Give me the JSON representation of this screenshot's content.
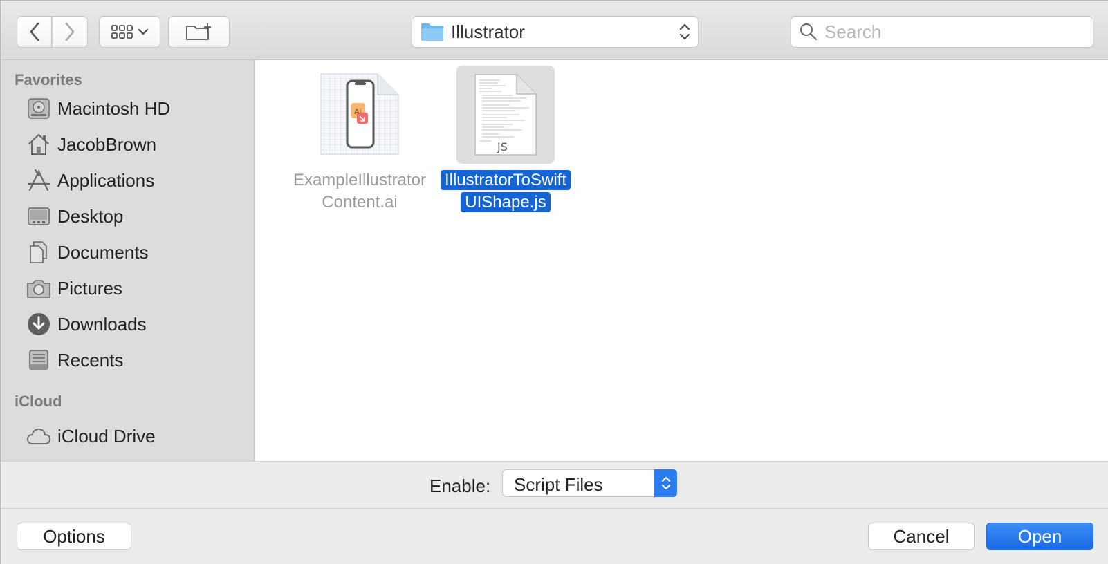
{
  "toolbar": {
    "back_icon": "chevron-left-icon",
    "forward_icon": "chevron-right-icon",
    "view_icon": "grid-view-icon",
    "new_folder_icon": "new-folder-icon",
    "location": "Illustrator",
    "search_placeholder": "Search"
  },
  "sidebar": {
    "favorites_title": "Favorites",
    "favorites": [
      {
        "label": "Macintosh HD",
        "icon": "hard-drive-icon"
      },
      {
        "label": "JacobBrown",
        "icon": "home-icon"
      },
      {
        "label": "Applications",
        "icon": "applications-icon"
      },
      {
        "label": "Desktop",
        "icon": "desktop-icon"
      },
      {
        "label": "Documents",
        "icon": "documents-icon"
      },
      {
        "label": "Pictures",
        "icon": "camera-icon"
      },
      {
        "label": "Downloads",
        "icon": "download-icon"
      },
      {
        "label": "Recents",
        "icon": "recents-icon"
      }
    ],
    "icloud_title": "iCloud",
    "icloud": [
      {
        "label": "iCloud Drive",
        "icon": "cloud-icon"
      }
    ]
  },
  "files": [
    {
      "line1": "ExampleIllustrator",
      "line2": "Content.ai",
      "selected": false,
      "thumb_badge": "Ai"
    },
    {
      "line1": "IllustratorToSwift",
      "line2": "UIShape.js",
      "selected": true,
      "thumb_badge": "JS"
    }
  ],
  "enable": {
    "label": "Enable:",
    "value": "Script Files"
  },
  "buttons": {
    "options": "Options",
    "cancel": "Cancel",
    "open": "Open"
  },
  "colors": {
    "accent": "#1464d6",
    "open_button": "#2a7cf0"
  }
}
